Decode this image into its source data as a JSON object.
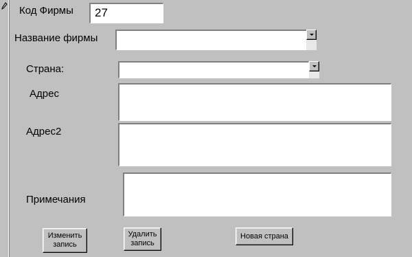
{
  "form": {
    "firm_code": {
      "label": "Код Фирмы",
      "value": "27"
    },
    "firm_name": {
      "label": "Название фирмы",
      "value": ""
    },
    "country": {
      "label": "Страна:",
      "value": ""
    },
    "address": {
      "label": "Адрес",
      "value": ""
    },
    "address2": {
      "label": "Адрес2",
      "value": ""
    },
    "notes": {
      "label": "Примечания",
      "value": ""
    }
  },
  "buttons": {
    "edit": "Изменить\nзапись",
    "delete": "Удалить\nзапись",
    "new_country": "Новая страна"
  },
  "icons": {
    "record_selector": "pencil-icon",
    "dropdown": "chevron-down-icon"
  }
}
